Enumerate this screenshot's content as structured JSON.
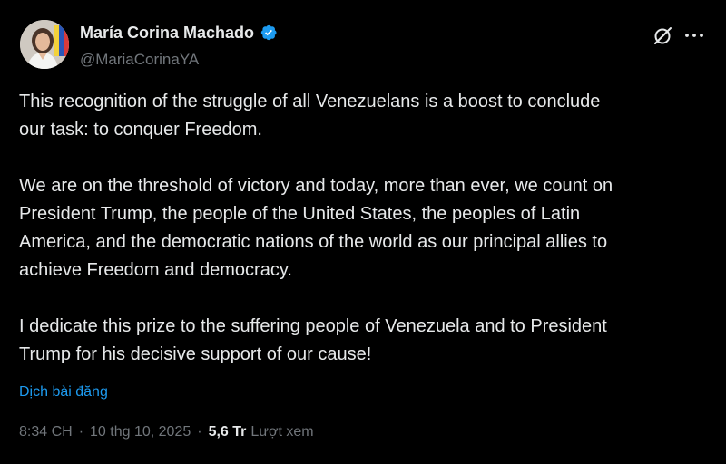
{
  "author": {
    "name": "María Corina Machado",
    "handle": "@MariaCorinaYA",
    "verified": true,
    "verified_color": "#1d9bf0"
  },
  "header_actions": {
    "grok_icon": "grok-slash-circle-icon",
    "more_icon": "more-horizontal-icon"
  },
  "post": {
    "paragraphs": [
      "This recognition of the struggle of all Venezuelans is a boost to conclude\nour task: to conquer Freedom.",
      "We are on the threshold of victory and today, more than ever, we count on\nPresident Trump, the people of the United States, the peoples of Latin\nAmerica, and the democratic nations of the world as our principal allies to\nachieve Freedom and democracy.",
      "I dedicate this prize to the suffering people of Venezuela and to President\nTrump for his decisive support of our cause!"
    ],
    "translate_label": "Dịch bài đăng"
  },
  "meta": {
    "time": "8:34 CH",
    "separator": "·",
    "date": "10 thg 10, 2025",
    "views_count": "5,6 Tr",
    "views_label": "Lượt xem"
  },
  "colors": {
    "background": "#000000",
    "text_primary": "#e7e9ea",
    "text_secondary": "#71767b",
    "link": "#1d9bf0",
    "divider": "#2f3336"
  }
}
